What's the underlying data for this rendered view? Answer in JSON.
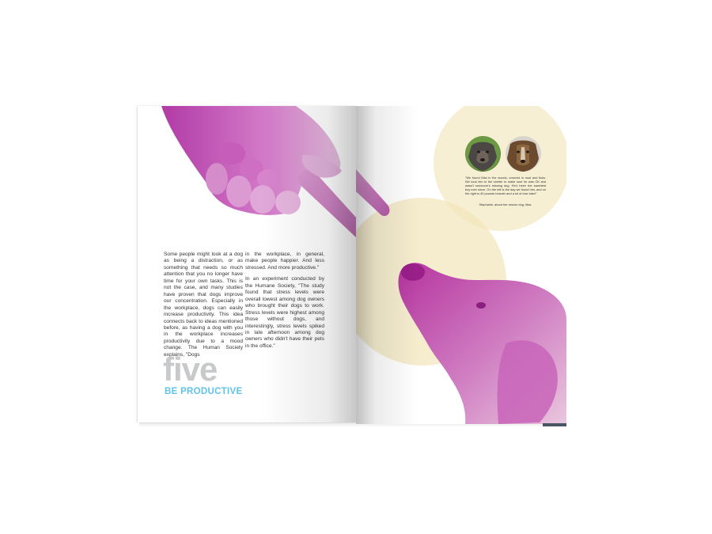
{
  "magazine": {
    "left_page": {
      "column1": "Some people might look at a dog as being a distraction, or as something that needs so much attention that you no longer have time for your own tasks. This is not the case, and many studies have proven that dogs improve our concentration. Especially in the workplace, dogs can easily increase productivity. This idea connects back to ideas mentioned before, as having a dog with you in the workplace increases productivity due to a mood change. The Human Society explains, \"Dogs",
      "column2_p1": "in the workplace, in general, make people happier. And less stressed. And more productive.\"",
      "column2_p2": "In an experiment conducted by the Humane Society, \"The study found that stress levels were overall lowest among dog owners who brought their dogs to work. Stress levels were highest among those without dogs, and interestingly, stress levels spiked in late afternoon among dog owners who didn't have their pets in the office.\"",
      "heading_number": "five",
      "heading_title": "BE PRODUCTIVE"
    },
    "right_page": {
      "quote": "\"We found Max in the woods, covered in mud and ticks. We took him to the shelter to make sure he was OK and wasn't someone's missing dog. He's been the sweetest boy ever since. On the left is the day we found him, and on the right is 40 pounds heavier and a lot of love later!\"",
      "attribution": "Stephanie, about her rescue dog, Max."
    }
  },
  "colors": {
    "accent_blue": "#5ec3ea",
    "heading_gray": "#c8c9ca",
    "magenta_tint": "#c653b8",
    "cream_circle": "#f1e4b5"
  }
}
